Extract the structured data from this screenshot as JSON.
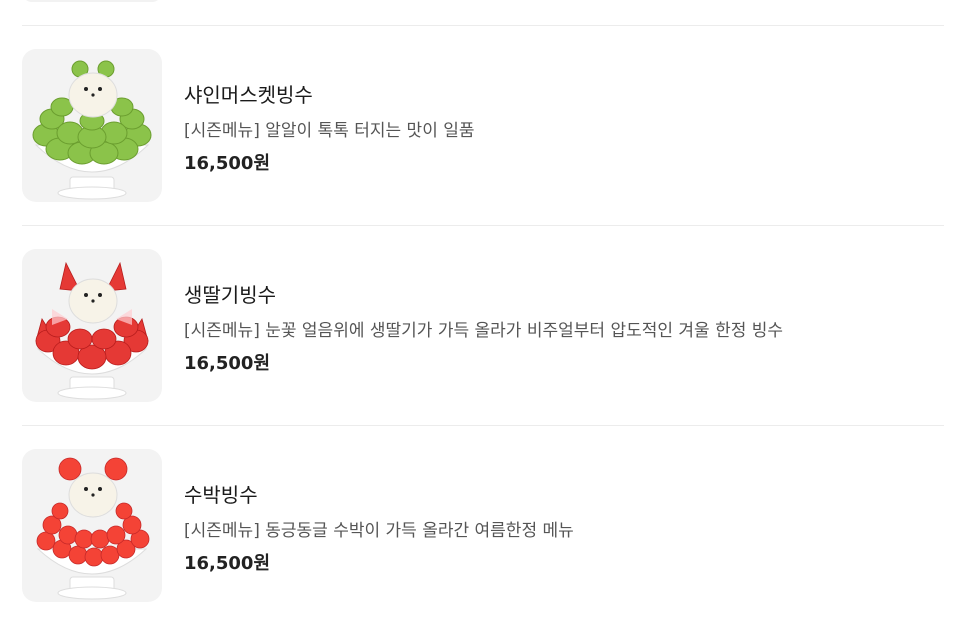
{
  "menu_items": [
    {
      "name": "샤인머스켓빙수",
      "description": "[시즌메뉴] 알알이 톡톡 터지는 맛이 일품",
      "price": "16,500원",
      "image_icon": "shine-muscat-bingsu-icon"
    },
    {
      "name": "생딸기빙수",
      "description": "[시즌메뉴] 눈꽃 얼음위에 생딸기가 가득 올라가 비주얼부터 압도적인 겨울 한정 빙수",
      "price": "16,500원",
      "image_icon": "strawberry-bingsu-icon"
    },
    {
      "name": "수박빙수",
      "description": "[시즌메뉴] 동긍동글 수박이 가득 올라간 여름한정 메뉴",
      "price": "16,500원",
      "image_icon": "watermelon-bingsu-icon"
    }
  ],
  "colors": {
    "muscat": "#8bc34a",
    "strawberry": "#e53935",
    "watermelon": "#f44336",
    "bowl": "#ffffff",
    "cream": "#f7f3e8"
  }
}
